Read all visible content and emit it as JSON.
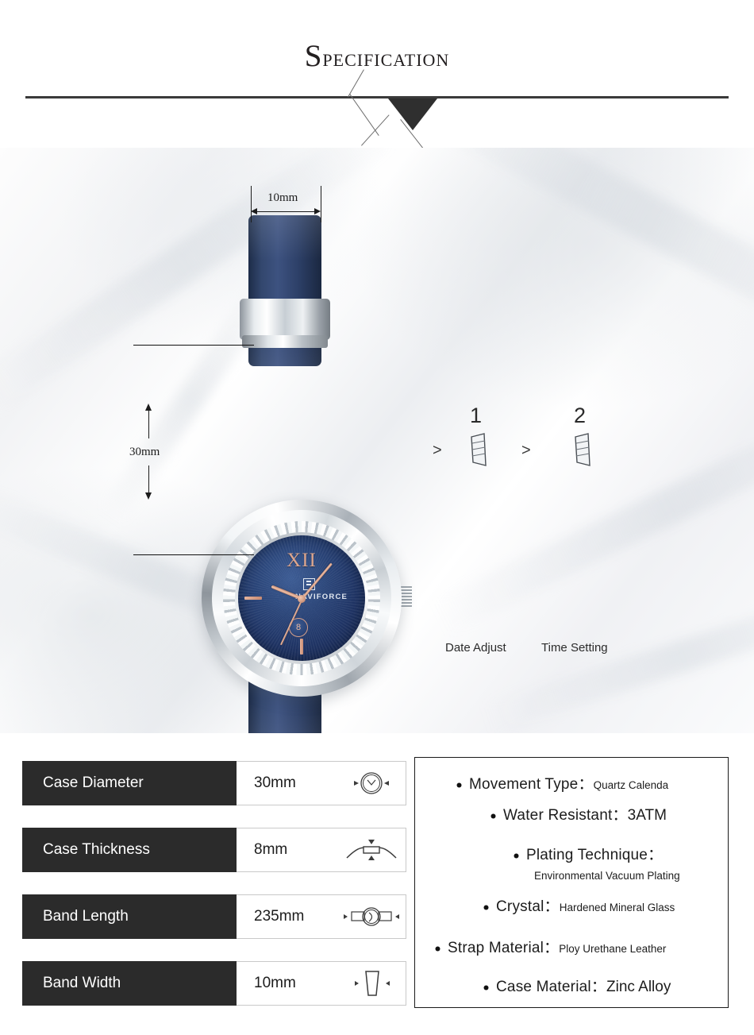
{
  "header": {
    "title": "Specification",
    "title_first_letter": "S",
    "title_rest": "pecification"
  },
  "diagram": {
    "band_width_label": "10mm",
    "case_diameter_label": "30mm",
    "dial_numeral": "XII",
    "dial_brand": "NAVIFORCE",
    "dial_date": "8",
    "crown_steps": [
      {
        "number": "1",
        "caption": "Date Adjust",
        "arrow": ">"
      },
      {
        "number": "2",
        "caption": "Time Setting",
        "arrow": ">"
      }
    ]
  },
  "spec_table": {
    "rows": [
      {
        "label": "Case Diameter",
        "value": "30mm",
        "icon": "watch-case-circle-icon"
      },
      {
        "label": "Case Thickness",
        "value": "8mm",
        "icon": "case-side-profile-icon"
      },
      {
        "label": "Band Length",
        "value": "235mm",
        "icon": "watch-band-length-icon"
      },
      {
        "label": "Band Width",
        "value": "10mm",
        "icon": "band-width-strip-icon"
      }
    ]
  },
  "spec_list": {
    "items": [
      {
        "key": "Movement Type",
        "sep": "：",
        "value": "Quartz Calenda",
        "value_size": "small"
      },
      {
        "key": "Water Resistant",
        "sep": "：",
        "value": "3ATM",
        "value_size": "large"
      },
      {
        "key": "Plating Technique",
        "sep": "：",
        "value": "Environmental Vacuum Plating",
        "value_size": "small",
        "wrap": true
      },
      {
        "key": "Crystal",
        "sep": "：",
        "value": "Hardened Mineral Glass",
        "value_size": "small"
      },
      {
        "key": "Strap Material",
        "sep": "：",
        "value": "Ploy Urethane Leather",
        "value_size": "small"
      },
      {
        "key": "Case Material",
        "sep": "：",
        "value": "Zinc Alloy",
        "value_size": "large"
      }
    ]
  },
  "colors": {
    "label_bg": "#2b2b2b",
    "dial_navy": "#1f3465",
    "strap_navy": "#283a5c",
    "rose_gold": "#dda68e",
    "rule": "#3a3a3a"
  }
}
